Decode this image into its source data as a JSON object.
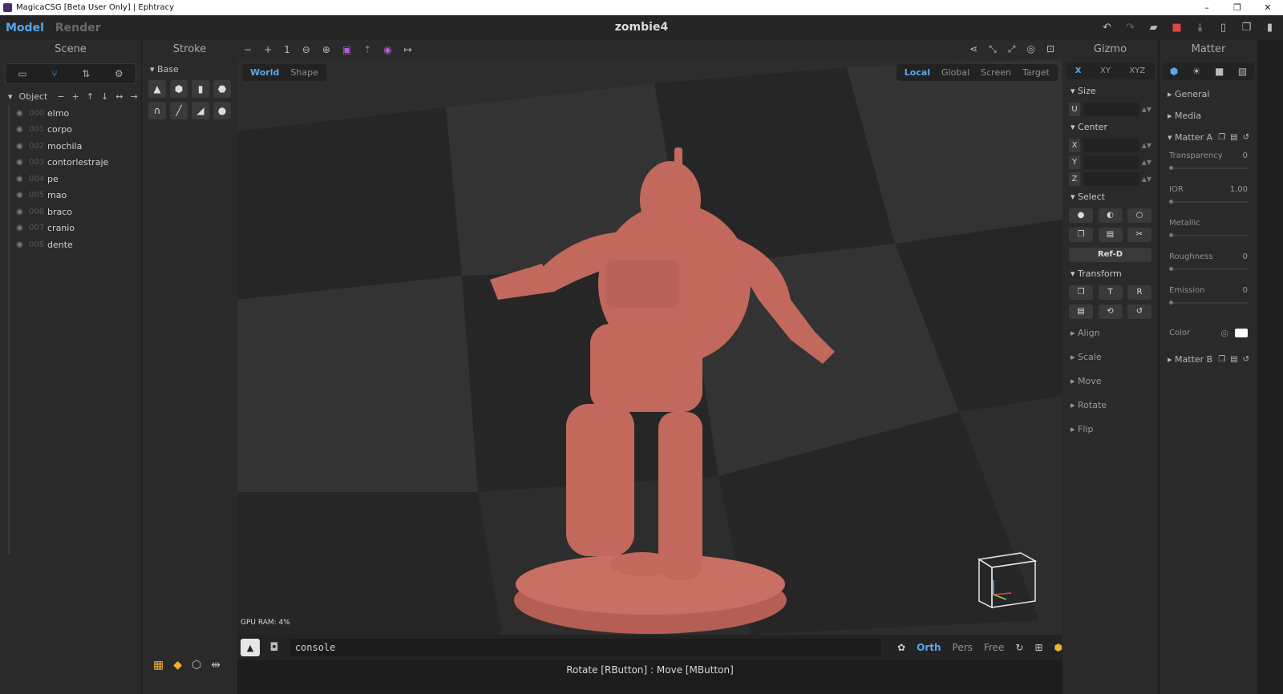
{
  "window": {
    "title": "MagicaCSG [Beta User Only] | Ephtracy",
    "controls": [
      "–",
      "❐",
      "✕"
    ]
  },
  "menubar": {
    "modes": [
      "Model",
      "Render"
    ],
    "active_mode": "Model",
    "doc_title": "zombie4",
    "icons": [
      "undo-icon",
      "redo-icon",
      "open-icon",
      "save-icon",
      "export-icon",
      "new-icon",
      "copy-icon",
      "delete-icon"
    ]
  },
  "scene": {
    "title": "Scene",
    "object_header": "Object",
    "objects": [
      {
        "idx": "000",
        "name": "elmo"
      },
      {
        "idx": "001",
        "name": "corpo"
      },
      {
        "idx": "002",
        "name": "mochila"
      },
      {
        "idx": "003",
        "name": "contorlestraje"
      },
      {
        "idx": "004",
        "name": "pe"
      },
      {
        "idx": "005",
        "name": "mao"
      },
      {
        "idx": "006",
        "name": "braco"
      },
      {
        "idx": "007",
        "name": "cranio"
      },
      {
        "idx": "008",
        "name": "dente"
      }
    ]
  },
  "stroke": {
    "title": "Stroke",
    "base_header": "Base"
  },
  "viewport": {
    "toolbar_count": "1",
    "space_tabs": [
      "World",
      "Shape"
    ],
    "space_active": "World",
    "gizmo_tabs": [
      "Local",
      "Global",
      "Screen",
      "Target"
    ],
    "gizmo_active": "Local",
    "gpu_ram": "GPU RAM:  4%"
  },
  "console": {
    "value": "console",
    "projections": [
      "Orth",
      "Pers",
      "Free"
    ],
    "active_projection": "Orth"
  },
  "status": {
    "text": "Rotate [RButton] : Move [MButton]"
  },
  "gizmo": {
    "title": "Gizmo",
    "axes": [
      "X",
      "XY",
      "XYZ"
    ],
    "axis_active": "X",
    "size_header": "Size",
    "center_header": "Center",
    "select_header": "Select",
    "ref_label": "Ref-D",
    "transform_header": "Transform",
    "transform_btn_t": "T",
    "transform_btn_r": "R",
    "collapsed": [
      "Align",
      "Scale",
      "Move",
      "Rotate",
      "Flip"
    ],
    "size_axis": "U",
    "center_axes": [
      "X",
      "Y",
      "Z"
    ]
  },
  "matter": {
    "title": "Matter",
    "sections": [
      "General",
      "Media"
    ],
    "matter_a": "Matter A",
    "matter_b": "Matter B",
    "props": [
      {
        "name": "Transparency",
        "value": "0"
      },
      {
        "name": "IOR",
        "value": "1.00"
      },
      {
        "name": "Metallic",
        "value": ""
      },
      {
        "name": "Roughness",
        "value": "0"
      },
      {
        "name": "Emission",
        "value": "0"
      }
    ],
    "color_label": "Color",
    "color_value": "#ffffff"
  }
}
